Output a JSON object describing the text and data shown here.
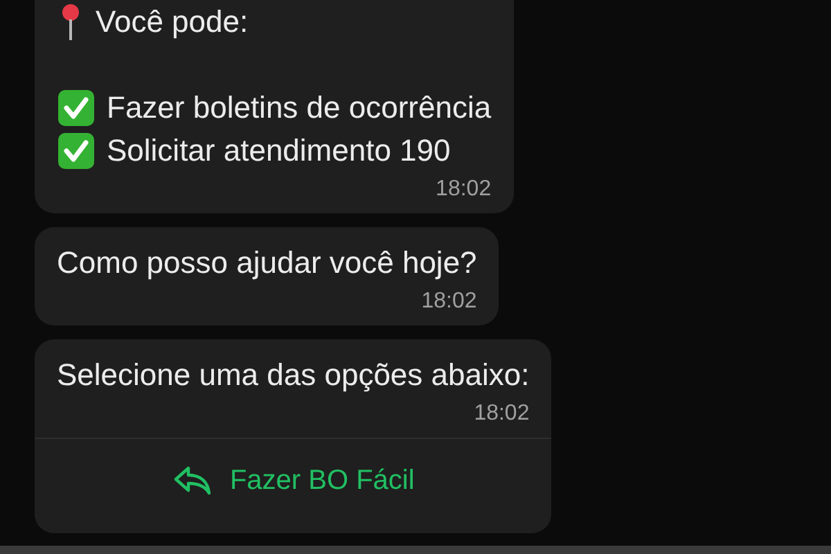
{
  "messages": [
    {
      "lines": [
        {
          "kind": "pin",
          "text": "Você pode:"
        },
        {
          "kind": "gap"
        },
        {
          "kind": "check",
          "text": "Fazer boletins de ocorrência"
        },
        {
          "kind": "check",
          "text": "Solicitar atendimento 190"
        }
      ],
      "time": "18:02"
    },
    {
      "lines": [
        {
          "kind": "plain",
          "text": "Como posso ajudar você hoje?"
        }
      ],
      "time": "18:02"
    },
    {
      "lines": [
        {
          "kind": "plain",
          "text": "Selecione uma das opções abaixo:"
        }
      ],
      "time": "18:02",
      "reply_button": "Fazer BO Fácil"
    }
  ]
}
